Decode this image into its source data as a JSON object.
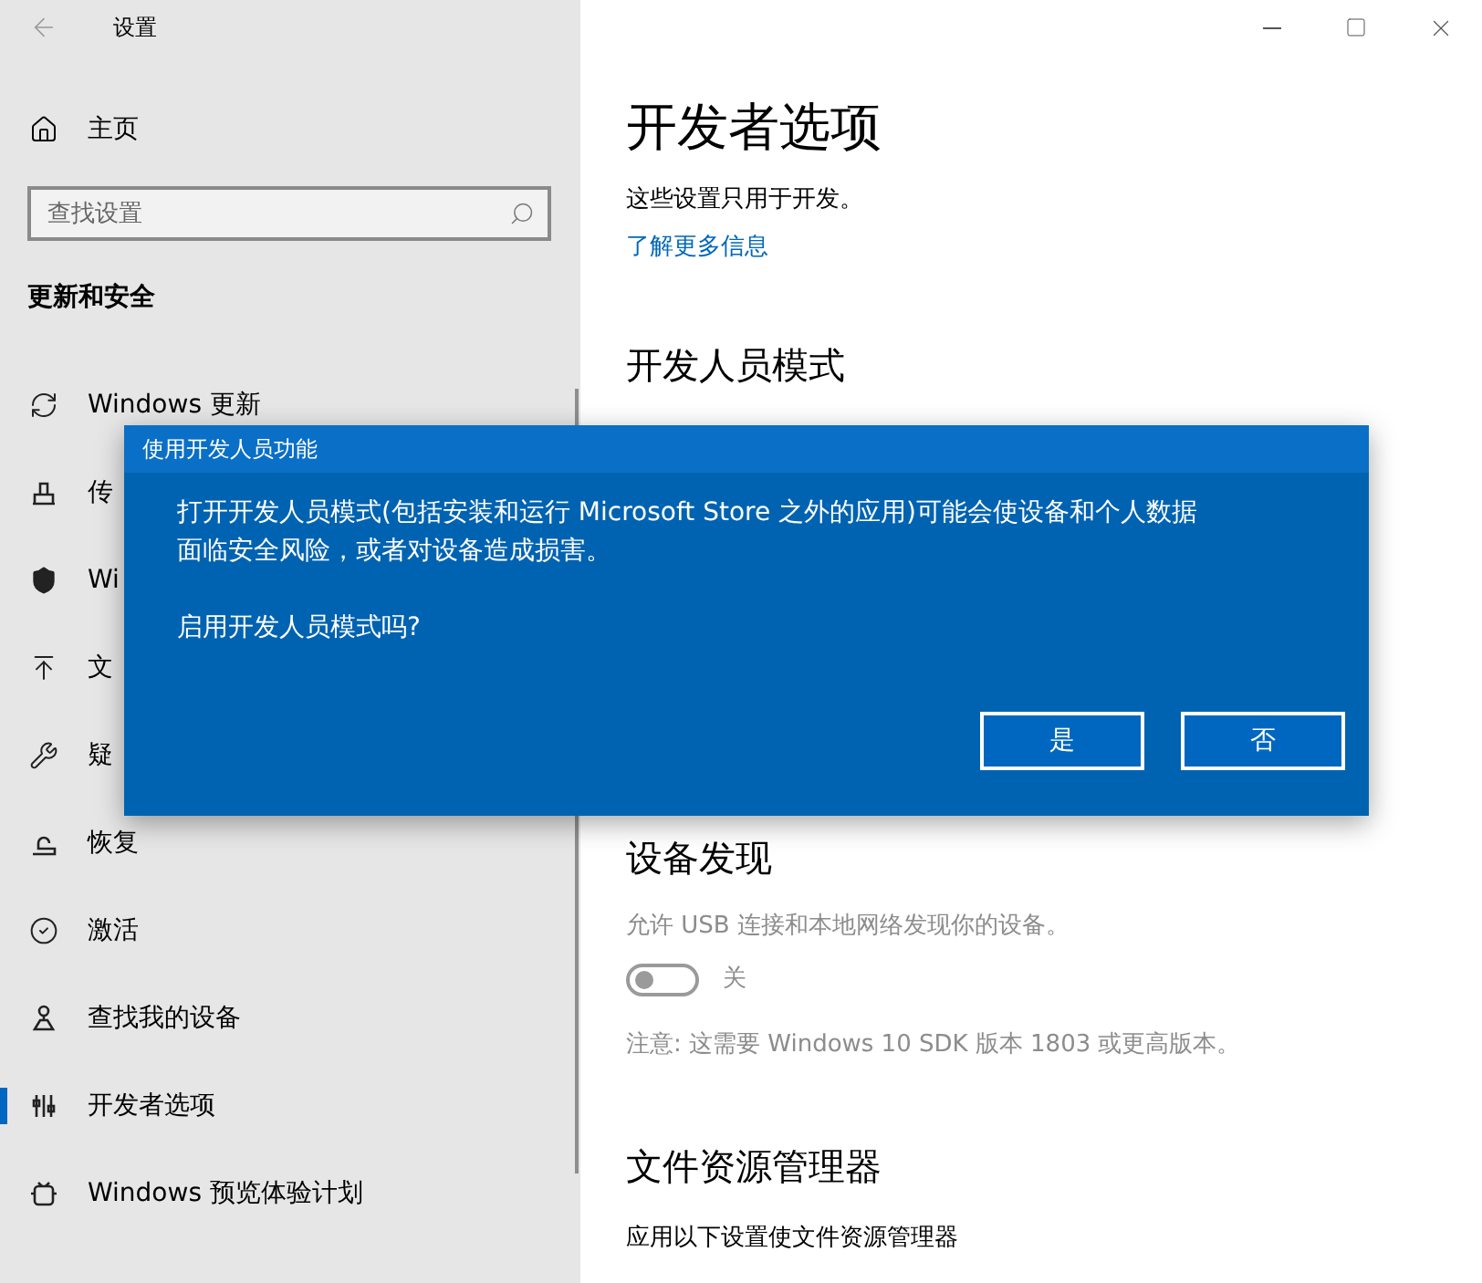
{
  "window": {
    "title": "设置"
  },
  "sidebar": {
    "home": "主页",
    "search": {
      "placeholder": "查找设置"
    },
    "section": "更新和安全",
    "items": [
      {
        "label": "Windows 更新",
        "selected": false
      },
      {
        "label": "传",
        "selected": false
      },
      {
        "label": "Wi",
        "selected": false
      },
      {
        "label": "文",
        "selected": false
      },
      {
        "label": "疑",
        "selected": false
      },
      {
        "label": "恢复",
        "selected": false
      },
      {
        "label": "激活",
        "selected": false
      },
      {
        "label": "查找我的设备",
        "selected": false
      },
      {
        "label": "开发者选项",
        "selected": true
      },
      {
        "label": "Windows 预览体验计划",
        "selected": false
      }
    ]
  },
  "page": {
    "title": "开发者选项",
    "intro": "这些设置只用于开发。",
    "link": "了解更多信息",
    "sections": [
      {
        "heading": "开发人员模式"
      },
      {
        "heading": "设备发现",
        "description": "允许 USB 连接和本地网络发现你的设备。",
        "toggle": {
          "on": false,
          "label": "关"
        },
        "note": "注意: 这需要 Windows 10 SDK 版本 1803 或更高版本。"
      },
      {
        "heading": "文件资源管理器",
        "description": "应用以下设置使文件资源管理器"
      }
    ]
  },
  "dialog": {
    "title": "使用开发人员功能",
    "message": "打开开发人员模式(包括安装和运行 Microsoft Store 之外的应用)可能会使设备和个人数据面临安全风险，或者对设备造成损害。",
    "question": "启用开发人员模式吗?",
    "buttons": [
      "是",
      "否"
    ]
  }
}
